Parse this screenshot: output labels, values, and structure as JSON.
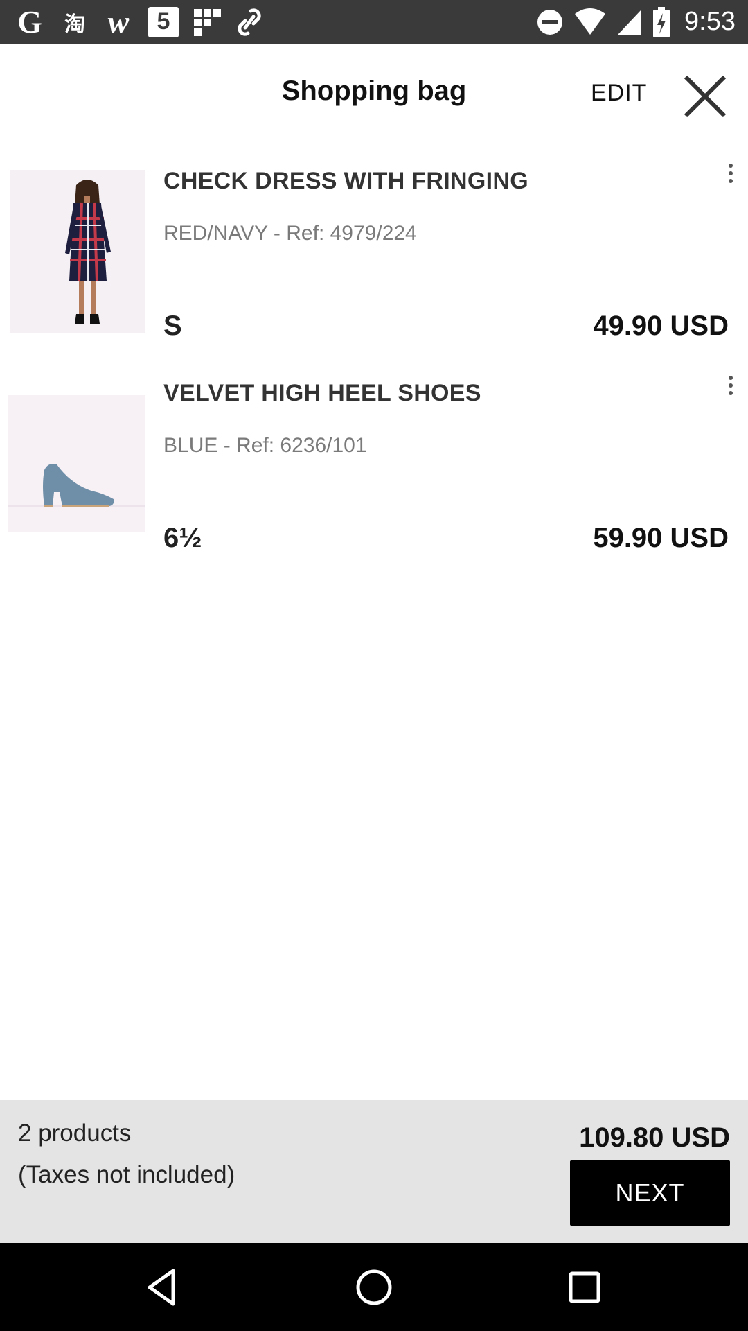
{
  "status_bar": {
    "left_icons": [
      "google-icon",
      "taobao-icon",
      "wish-icon",
      "five-icon",
      "grid-app-icon",
      "link-icon"
    ],
    "G_text": "G",
    "cn_text": "淘",
    "w_text": "w",
    "five_text": "5",
    "right_icons": [
      "do-not-disturb-icon",
      "wifi-icon",
      "cellular-signal-icon",
      "battery-charging-icon"
    ],
    "time": "9:53"
  },
  "header": {
    "title": "Shopping bag",
    "edit_label": "EDIT",
    "close_icon": "close-icon"
  },
  "items": [
    {
      "name": "CHECK DRESS WITH FRINGING",
      "color_ref": "RED/NAVY - Ref: 4979/224",
      "size": "S",
      "price": "49.90 USD",
      "thumbnail": "dress-thumbnail"
    },
    {
      "name": "VELVET HIGH HEEL SHOES",
      "color_ref": "BLUE - Ref: 6236/101",
      "size": "6½",
      "price": "59.90 USD",
      "thumbnail": "shoes-thumbnail"
    }
  ],
  "footer": {
    "product_count": "2 products",
    "taxes_note": "(Taxes not included)",
    "total": "109.80 USD",
    "next_label": "NEXT"
  },
  "nav_bar": {
    "buttons": [
      "back-icon",
      "home-icon",
      "recents-icon"
    ]
  },
  "colors": {
    "status_bar": "#3a3a3a",
    "footer_bg": "#e4e4e4",
    "next_button": "#000000",
    "nav_bar": "#000000"
  }
}
